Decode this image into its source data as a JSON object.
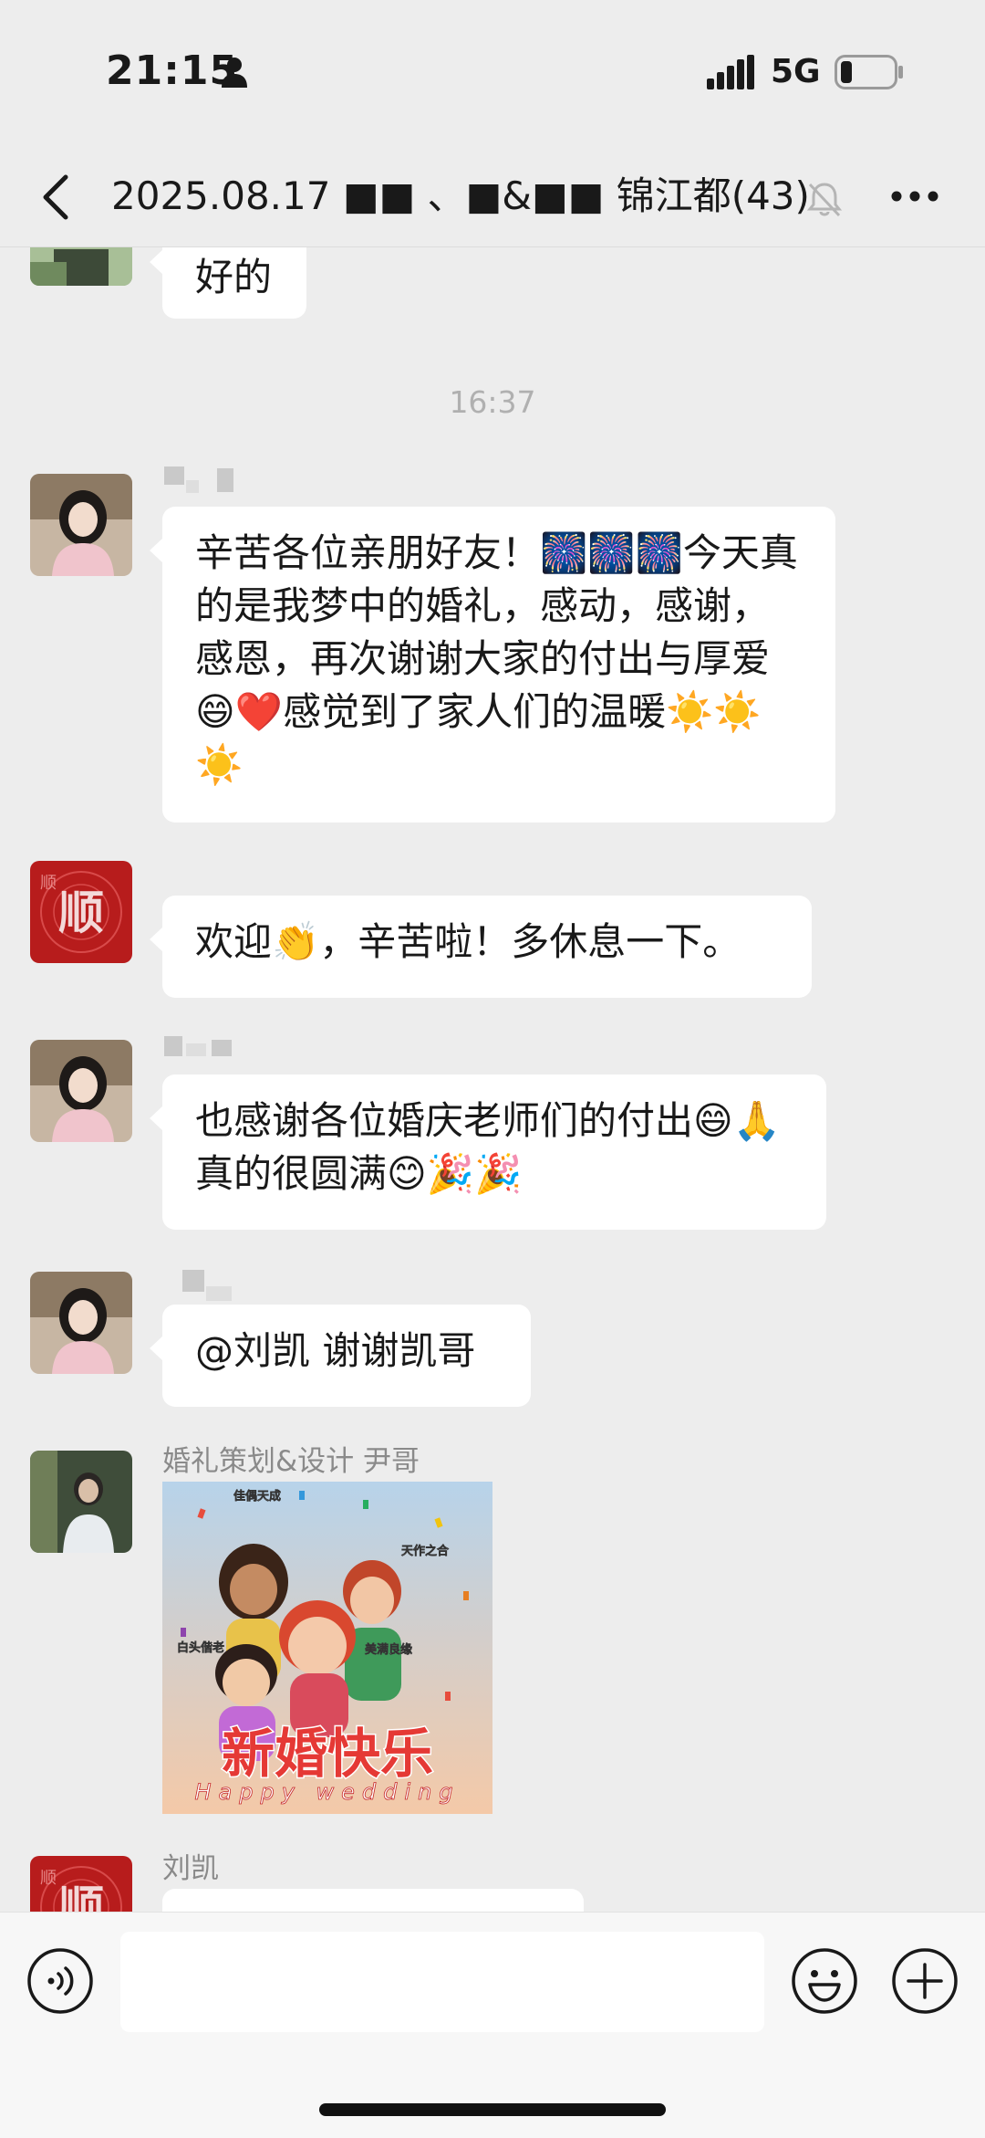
{
  "status_bar": {
    "time": "21:15",
    "network": "5G"
  },
  "nav": {
    "title": "2025.08.17 ■■ 、■&■■ 锦江都(43)"
  },
  "chat": {
    "messages": [
      {
        "kind": "text",
        "text": "好的"
      },
      {
        "kind": "time",
        "text": "16:37"
      },
      {
        "kind": "text",
        "text": "辛苦各位亲朋好友！🎆🎆🎆今天真的是我梦中的婚礼，感动，感谢，感恩，再次谢谢大家的付出与厚爱😄❤️感觉到了家人们的温暖☀️☀️☀️"
      },
      {
        "kind": "text",
        "text": "欢迎👏，辛苦啦！多休息一下。"
      },
      {
        "kind": "text",
        "text": "也感谢各位婚庆老师们的付出😄🙏真的很圆满😊🎉🎉"
      },
      {
        "kind": "text",
        "text": "@刘凯 谢谢凯哥"
      },
      {
        "kind": "image",
        "sender": "婚礼策划&设计 尹哥",
        "image": {
          "title": "新婚快乐",
          "subtitle": "Happy wedding",
          "tags": [
            "佳偶天成",
            "天作之合",
            "白头偕老",
            "美满良缘"
          ]
        }
      },
      {
        "kind": "text",
        "sender": "刘凯",
        "text": ""
      }
    ],
    "avatar_shun": {
      "center_char": "顺",
      "corner_char": "顺"
    }
  },
  "colors": {
    "background": "#ededed",
    "bubble": "#ffffff",
    "shun_avatar": "#b71c1c"
  },
  "icons": [
    "person-icon",
    "signal-icon",
    "battery-icon",
    "back-icon",
    "mute-icon",
    "more-icon",
    "voice-icon",
    "emoji-icon",
    "plus-icon"
  ],
  "input": {
    "value": "",
    "placeholder": ""
  }
}
